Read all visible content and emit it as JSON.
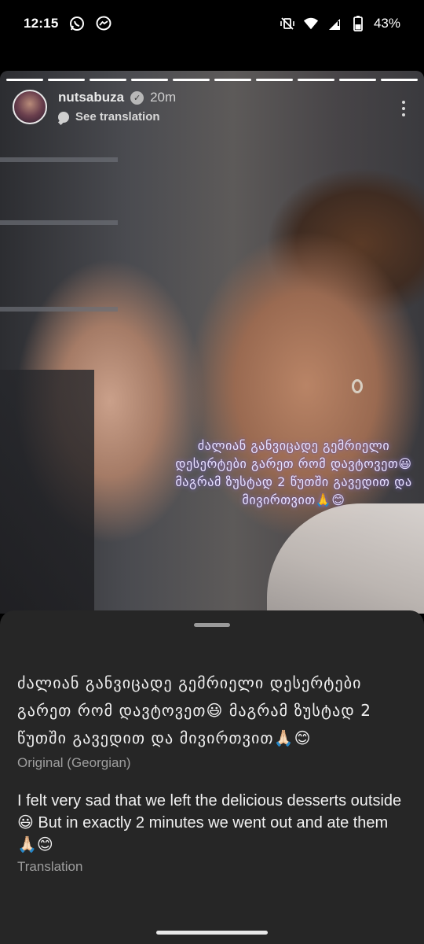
{
  "status_bar": {
    "time": "12:15",
    "notification_icons": [
      "whatsapp-icon",
      "messenger-icon"
    ],
    "system_icons": [
      "vibrate-off-icon",
      "wifi-icon",
      "signal-icon",
      "battery-icon"
    ],
    "battery": "43%"
  },
  "story": {
    "progress_segments_total": 10,
    "progress_segments_done": 10,
    "username": "nutsabuza",
    "time_ago": "20m",
    "see_translation": "See translation",
    "caption": "ძალიან განვიცადე გემრიელი დესერტები გარეთ რომ დავტოვეთ😃 მაგრამ ზუსტად 2 წუთში გავედით და მივირთვით🙏😊"
  },
  "sheet": {
    "original_text": "ძალიან განვიცადე გემრიელი დესერტები გარეთ რომ დავტოვეთ😃 მაგრამ ზუსტად 2 წუთში გავედით და მივირთვით🙏🏻😊",
    "original_label": "Original (Georgian)",
    "translation_text": "I felt very sad that we left the delicious desserts outside😃 But in exactly 2 minutes we went out and ate them🙏🏻😊",
    "translation_label": "Translation"
  }
}
